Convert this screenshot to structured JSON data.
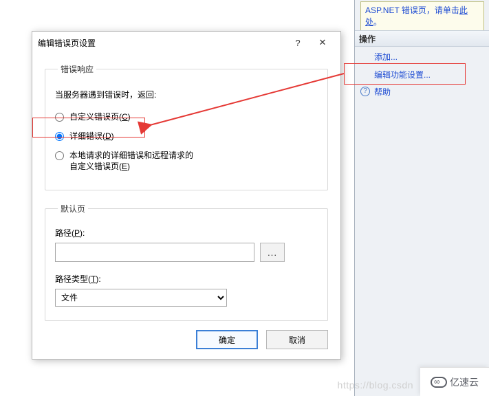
{
  "side": {
    "info_prefix": "ASP.NET 错误页，请单击",
    "info_link": "此处",
    "info_suffix": "。",
    "ops_title": "操作",
    "add": "添加...",
    "edit": "编辑功能设置...",
    "help": "帮助"
  },
  "dialog": {
    "title": "编辑错误页设置",
    "help_icon": "?",
    "close_icon": "✕",
    "group_response": "错误响应",
    "response_desc": "当服务器遇到错误时，返回:",
    "radio_custom": "自定义错误页(",
    "radio_custom_key": "C",
    "radio_detail": "详细错误(",
    "radio_detail_key": "D",
    "radio_localdetail_l1": "本地请求的详细错误和远程请求的",
    "radio_localdetail_l2_pre": "自定义错误页(",
    "radio_localdetail_key": "E",
    "paren_close": ")",
    "group_default": "默认页",
    "path_label_pre": "路径(",
    "path_label_key": "P",
    "path_label_post": "):",
    "path_value": "",
    "browse": "...",
    "type_label_pre": "路径类型(",
    "type_label_key": "T",
    "type_label_post": "):",
    "type_selected": "文件",
    "ok": "确定",
    "cancel": "取消"
  },
  "footer": {
    "watermark": "https://blog.csdn",
    "logo": "亿速云"
  }
}
